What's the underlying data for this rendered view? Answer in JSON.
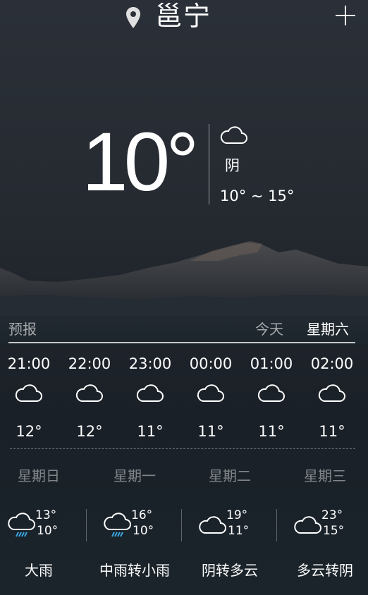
{
  "header": {
    "location_icon": "map-pin-icon",
    "city": "邕宁",
    "add_icon": "plus-icon"
  },
  "current": {
    "temperature": "10°",
    "condition_icon": "cloud-icon",
    "condition": "阴",
    "range": "10° ~ 15°"
  },
  "forecast": {
    "title": "预报",
    "today": "今天",
    "weekday": "星期六"
  },
  "hourly": [
    {
      "time": "21:00",
      "icon": "cloud-icon",
      "temp": "12°"
    },
    {
      "time": "22:00",
      "icon": "cloud-icon",
      "temp": "12°"
    },
    {
      "time": "23:00",
      "icon": "cloud-icon",
      "temp": "11°"
    },
    {
      "time": "00:00",
      "icon": "cloud-icon",
      "temp": "11°"
    },
    {
      "time": "01:00",
      "icon": "cloud-icon",
      "temp": "11°"
    },
    {
      "time": "02:00",
      "icon": "cloud-icon",
      "temp": "11°"
    }
  ],
  "daily": [
    {
      "day": "星期日",
      "icon": "rain-cloud-icon",
      "high": "13°",
      "low": "10°",
      "desc": "大雨"
    },
    {
      "day": "星期一",
      "icon": "rain-cloud-icon",
      "high": "16°",
      "low": "10°",
      "desc": "中雨转小雨"
    },
    {
      "day": "星期二",
      "icon": "cloud-icon",
      "high": "19°",
      "low": "11°",
      "desc": "阴转多云"
    },
    {
      "day": "星期三",
      "icon": "cloud-icon",
      "high": "23°",
      "low": "15°",
      "desc": "多云转阴"
    }
  ],
  "colors": {
    "text": "#ffffff",
    "muted": "#9aa0a8",
    "rain": "#3aa6e0"
  }
}
